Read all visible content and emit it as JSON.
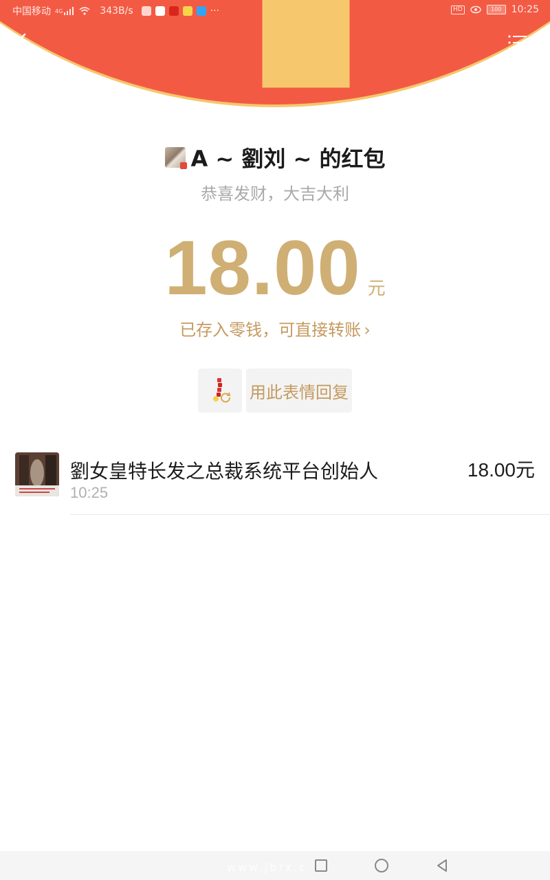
{
  "status_bar": {
    "carrier": "中国移动",
    "network": "4G",
    "speed": "343B/s",
    "more": "···",
    "battery": "100",
    "time": "10:25"
  },
  "colors": {
    "header_red": "#f35a44",
    "header_border": "#f6c76d",
    "amount_gold": "#cfaf74",
    "link_gold": "#c49a5f"
  },
  "nav": {
    "back_icon": "chevron-left-icon",
    "menu_icon": "list-menu-icon"
  },
  "packet": {
    "sender_name": "A ~ 劉刘 ~ 的红包",
    "wish": "恭喜发财，大吉大利",
    "amount": "18.00",
    "unit": "元",
    "saved_note": "已存入零钱，可直接转账",
    "saved_arrow": "›",
    "reply_label": "用此表情回复"
  },
  "records": [
    {
      "name": "劉女皇特长发之总裁系统平台创始人",
      "time": "10:25",
      "amount": "18.00元"
    }
  ],
  "watermark": "www.jbrx.c"
}
